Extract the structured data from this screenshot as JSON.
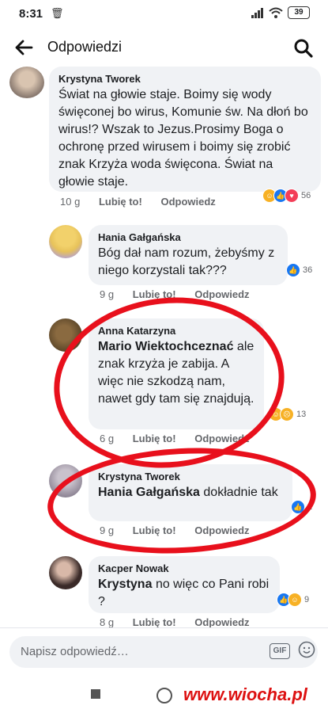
{
  "status_bar": {
    "time": "8:31",
    "battery": "39"
  },
  "header": {
    "title": "Odpowiedzi"
  },
  "comments": [
    {
      "author": "Krystyna Tworek",
      "mention": "",
      "text": "Świat na głowie staje. Boimy się wody święconej bo wirus, Komunie św. Na dłoń bo wirus!? Wszak to Jezus.Prosimy Boga o ochronę przed wirusem i boimy się zrobić znak Krzyża woda święcona. Świat na głowie staje.",
      "time": "10 g",
      "like": "Lubię to!",
      "reply": "Odpowiedz",
      "reaction_count": "56"
    },
    {
      "author": "Hania Gałgańska",
      "mention": "",
      "text": "Bóg dał nam rozum, żebyśmy z niego korzystali tak???",
      "time": "9 g",
      "like": "Lubię to!",
      "reply": "Odpowiedz",
      "reaction_count": "36"
    },
    {
      "author": "Anna Katarzyna",
      "mention": "Mario Wiektochceznać",
      "text": "ale znak krzyża je zabija. A więc nie szkodzą nam, nawet gdy tam się znajdują.",
      "time": "6 g",
      "like": "Lubię to!",
      "reply": "Odpowiedz",
      "reaction_count": "13"
    },
    {
      "author": "Krystyna Tworek",
      "mention": "Hania Gałgańska",
      "text": "dokładnie tak",
      "time": "9 g",
      "like": "Lubię to!",
      "reply": "Odpowiedz",
      "reaction_count": "1"
    },
    {
      "author": "Kacper Nowak",
      "mention": "Krystyna",
      "text": "no więc co Pani robi ?",
      "time": "8 g",
      "like": "Lubię to!",
      "reply": "Odpowiedz",
      "reaction_count": "9"
    }
  ],
  "compose": {
    "placeholder": "Napisz odpowiedź…",
    "gif_label": "GIF"
  },
  "watermark": "www.wiocha.pl",
  "colors": {
    "like": "#1877f2",
    "love": "#f33e58",
    "haha": "#f7b125",
    "annotation_ring": "#e8101c"
  }
}
